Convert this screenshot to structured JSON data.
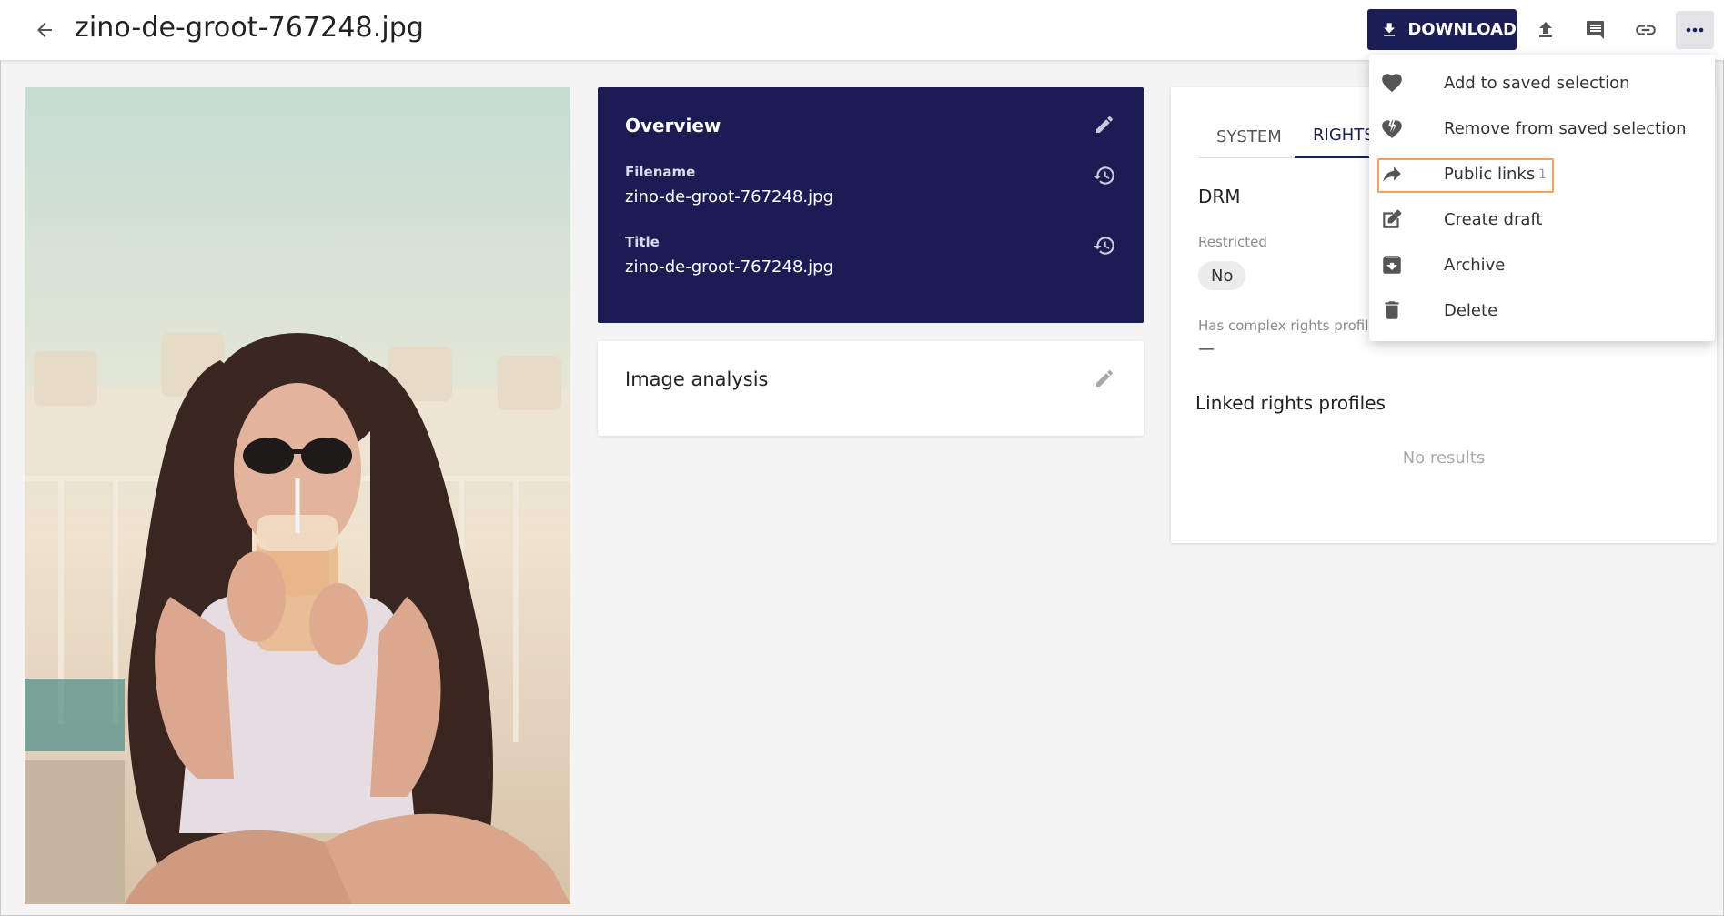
{
  "header": {
    "title": "zino-de-groot-767248.jpg",
    "download_label": "DOWNLOAD",
    "icons": [
      "back-arrow-icon",
      "upload-icon",
      "comment-icon",
      "link-icon",
      "more-icon"
    ]
  },
  "overview": {
    "title": "Overview",
    "fields": [
      {
        "label": "Filename",
        "value": "zino-de-groot-767248.jpg"
      },
      {
        "label": "Title",
        "value": "zino-de-groot-767248.jpg"
      }
    ]
  },
  "analysis": {
    "title": "Image analysis"
  },
  "rights": {
    "tabs": [
      {
        "label": "SYSTEM",
        "active": false
      },
      {
        "label": "RIGHTS",
        "active": true
      }
    ],
    "drm_title": "DRM",
    "restricted_label": "Restricted",
    "restricted_value": "No",
    "complex_label": "Has complex rights profile",
    "complex_value": "—",
    "linked_title": "Linked rights profiles",
    "no_results": "No results"
  },
  "menu": {
    "items": [
      {
        "label": "Add to saved selection",
        "icon": "heart-icon"
      },
      {
        "label": "Remove from saved selection",
        "icon": "heart-broken-icon"
      },
      {
        "label": "Public links",
        "icon": "share-arrow-icon",
        "badge": "1",
        "highlighted": true
      },
      {
        "label": "Create draft",
        "icon": "edit-square-icon"
      },
      {
        "label": "Archive",
        "icon": "archive-icon"
      },
      {
        "label": "Delete",
        "icon": "trash-icon"
      }
    ]
  },
  "colors": {
    "primary": "#1b1f55",
    "highlight": "#f0a35a",
    "background": "#f4f4f4"
  }
}
